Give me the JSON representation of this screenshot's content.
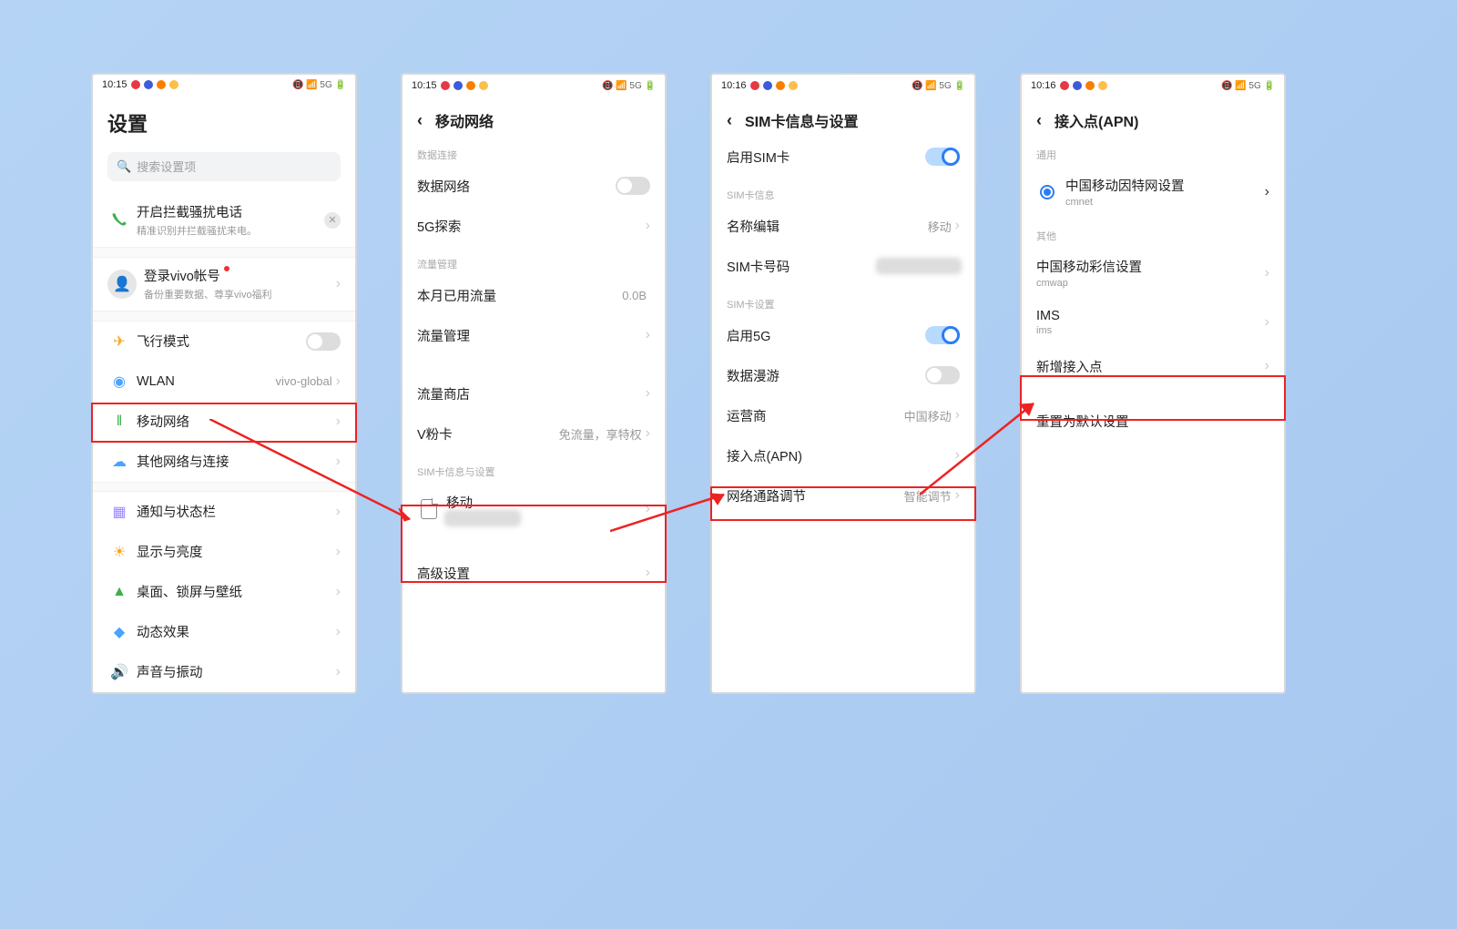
{
  "status": {
    "time_a": "10:15",
    "time_b": "10:16",
    "right": "📵 📶 5G 🔋"
  },
  "p1": {
    "title": "设置",
    "search_placeholder": "搜索设置项",
    "block": {
      "title": "开启拦截骚扰电话",
      "sub": "精准识别并拦截骚扰来电。"
    },
    "account": {
      "title": "登录vivo帐号",
      "sub": "备份重要数据、尊享vivo福利"
    },
    "rows": {
      "airplane": "飞行模式",
      "wlan": "WLAN",
      "wlan_val": "vivo-global",
      "mobile": "移动网络",
      "other": "其他网络与连接",
      "notif": "通知与状态栏",
      "display": "显示与亮度",
      "desktop": "桌面、锁屏与壁纸",
      "motion": "动态效果",
      "sound": "声音与振动"
    }
  },
  "p2": {
    "title": "移动网络",
    "sec_data": "数据连接",
    "data_net": "数据网络",
    "five_g": "5G探索",
    "sec_traffic": "流量管理",
    "month_used": "本月已用流量",
    "month_val": "0.0B",
    "traffic_mgmt": "流量管理",
    "traffic_store": "流量商店",
    "vcard": "V粉卡",
    "vcard_val": "免流量，享特权",
    "sec_sim": "SIM卡信息与设置",
    "sim_name": "移动",
    "advanced": "高级设置"
  },
  "p3": {
    "title": "SIM卡信息与设置",
    "enable_sim": "启用SIM卡",
    "sec_info": "SIM卡信息",
    "name_edit": "名称编辑",
    "name_val": "移动",
    "sim_number": "SIM卡号码",
    "sec_settings": "SIM卡设置",
    "enable_5g": "启用5G",
    "roaming": "数据漫游",
    "carrier": "运营商",
    "carrier_val": "中国移动",
    "apn": "接入点(APN)",
    "net_tune": "网络通路调节",
    "net_tune_val": "智能调节"
  },
  "p4": {
    "title": "接入点(APN)",
    "sec_general": "通用",
    "apn1": {
      "title": "中国移动因特网设置",
      "sub": "cmnet"
    },
    "sec_other": "其他",
    "apn2": {
      "title": "中国移动彩信设置",
      "sub": "cmwap"
    },
    "apn3": {
      "title": "IMS",
      "sub": "ims"
    },
    "new_apn": "新增接入点",
    "reset": "重置为默认设置"
  }
}
